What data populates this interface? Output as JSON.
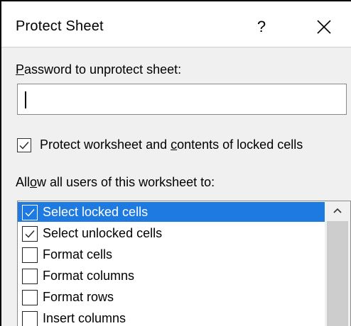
{
  "dialog": {
    "title": "Protect Sheet",
    "help_label": "?"
  },
  "password": {
    "label_accel": "P",
    "label_rest": "assword to unprotect sheet:",
    "value": ""
  },
  "protect_option": {
    "label_pre": "Protect worksheet and ",
    "label_accel": "c",
    "label_post": "ontents of locked cells",
    "checked": true
  },
  "allow": {
    "label_pre": "All",
    "label_accel": "o",
    "label_post": "w all users of this worksheet to:"
  },
  "permissions": [
    {
      "label": "Select locked cells",
      "checked": true,
      "selected": true
    },
    {
      "label": "Select unlocked cells",
      "checked": true,
      "selected": false
    },
    {
      "label": "Format cells",
      "checked": false,
      "selected": false
    },
    {
      "label": "Format columns",
      "checked": false,
      "selected": false
    },
    {
      "label": "Format rows",
      "checked": false,
      "selected": false
    },
    {
      "label": "Insert columns",
      "checked": false,
      "selected": false
    }
  ],
  "colors": {
    "selection": "#1e7ae0",
    "dialog_bg": "#f0f0f0"
  }
}
